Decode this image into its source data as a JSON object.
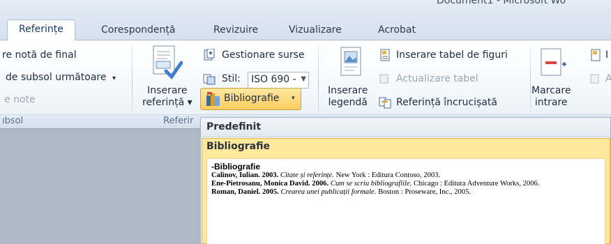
{
  "window": {
    "title_fragment": "Document1 - Microsoft Wo"
  },
  "tabs": [
    {
      "label": "Referințe",
      "active": true
    },
    {
      "label": "Corespondență",
      "active": false
    },
    {
      "label": "Revizuire",
      "active": false
    },
    {
      "label": "Vizualizare",
      "active": false
    },
    {
      "label": "Acrobat",
      "active": false
    }
  ],
  "ribbon": {
    "footnotes": {
      "insert_endnote": "re notă de final",
      "next_footnote": "de subsol următoare",
      "next_footnote_arrow": "▾",
      "show_notes": "e note",
      "group_label": "ıbsol"
    },
    "citations": {
      "insert_citation_line1": "Inserare",
      "insert_citation_line2": "referință ▾",
      "manage_sources": "Gestionare surse",
      "style_label": "Stil:",
      "style_value": "ISO 690 -",
      "bibliography_label": "Bibliografie",
      "bibliography_arrow": "▾",
      "group_label": "Referir"
    },
    "captions": {
      "insert_caption_line1": "Inserare",
      "insert_caption_line2": "legendă",
      "insert_table_of_figures": "Inserare tabel de figuri",
      "update_table": "Actualizare tabel",
      "cross_reference": "Referință încrucișată"
    },
    "index": {
      "mark_entry_line1": "Marcare",
      "mark_entry_line2": "intrare",
      "cut_i": "I",
      "cut_a": "A"
    }
  },
  "gallery": {
    "header": "Predefinit",
    "item_title": "Bibliografie",
    "preview": {
      "title": "Bibliografie",
      "entries": [
        {
          "author_year": "Calinov, Iulian. 2003.",
          "title": "Citate și referințe.",
          "rest": "New York : Editura Contoso, 2003."
        },
        {
          "author_year": "Ene-Pietrosanu, Monica David. 2006.",
          "title": "Cum se scriu bibliografiile.",
          "rest": "Chicago : Editura Adventure Works, 2006."
        },
        {
          "author_year": "Roman, Daniel. 2005.",
          "title": "Crearea unei publicații formale.",
          "rest": "Boston : Proseware, Inc., 2005."
        }
      ]
    }
  },
  "colors": {
    "active_button": "#fbcd60",
    "gallery_highlight": "#fde89c",
    "ribbon_background": "#f4f8fc",
    "text": "#1f2d40",
    "disabled_text": "#9aa6b4"
  },
  "icons": {
    "insert_citation": "citation-document-icon",
    "manage_sources": "manage-sources-icon",
    "style": "style-icon",
    "bibliography": "bibliography-books-icon",
    "insert_caption": "caption-picture-icon",
    "table_of_figures": "table-of-figures-icon",
    "update_table": "update-table-icon",
    "cross_reference": "cross-reference-icon",
    "mark_entry": "mark-entry-icon"
  }
}
